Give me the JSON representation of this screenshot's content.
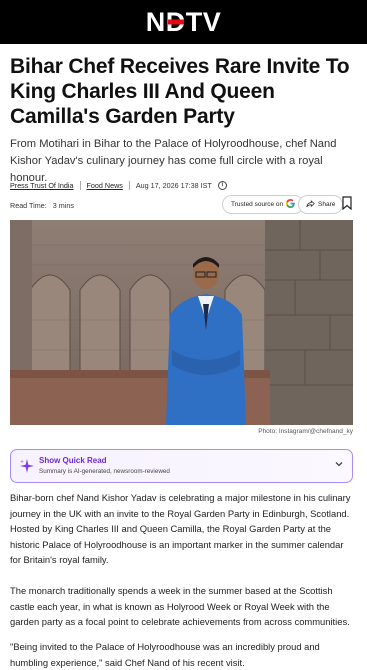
{
  "header": {
    "logo_text": "NDTV",
    "logo_accent_color": "#e50914"
  },
  "article": {
    "headline": "Bihar Chef Receives Rare Invite To King Charles III And Queen Camilla's Garden Party",
    "summary": "From Motihari in Bihar to the Palace of Holyroodhouse, chef Nand Kishor Yadav's culinary journey has come full circle with a royal honour.",
    "meta": {
      "source": "Press Trust Of India",
      "category": "Food News",
      "date": "Aug 17, 2026 17:38 IST",
      "info_icon": "info-icon"
    },
    "read_time_label": "Read Time:",
    "read_time_value": "3 mins",
    "trusted_label": "Trusted source on",
    "share_label": "Share",
    "photo_credit": "Photo: Instagram/@chefnand_ky",
    "quick_read": {
      "title": "Show Quick Read",
      "subtitle": "Summary is AI-generated, newsroom-reviewed",
      "accent_color": "#6d28d9"
    },
    "paragraphs": [
      "Bihar-born chef Nand Kishor Yadav is celebrating a major milestone in his culinary journey in the UK with an invite to the Royal Garden Party in Edinburgh, Scotland. Hosted by King Charles III and Queen Camilla, the Royal Garden Party at the historic Palace of Holyroodhouse is an important marker in the summer calendar for Britain's royal family.",
      "The monarch traditionally spends a week in the summer based at the Scottish castle each year, in what is known as Holyrood Week or Royal Week with the garden party as a focal point to celebrate achievements from across communities.",
      "\"Being invited to the Palace of Holyroodhouse was an incredibly proud and humbling experience,\" said Chef Nand of his recent visit."
    ]
  }
}
